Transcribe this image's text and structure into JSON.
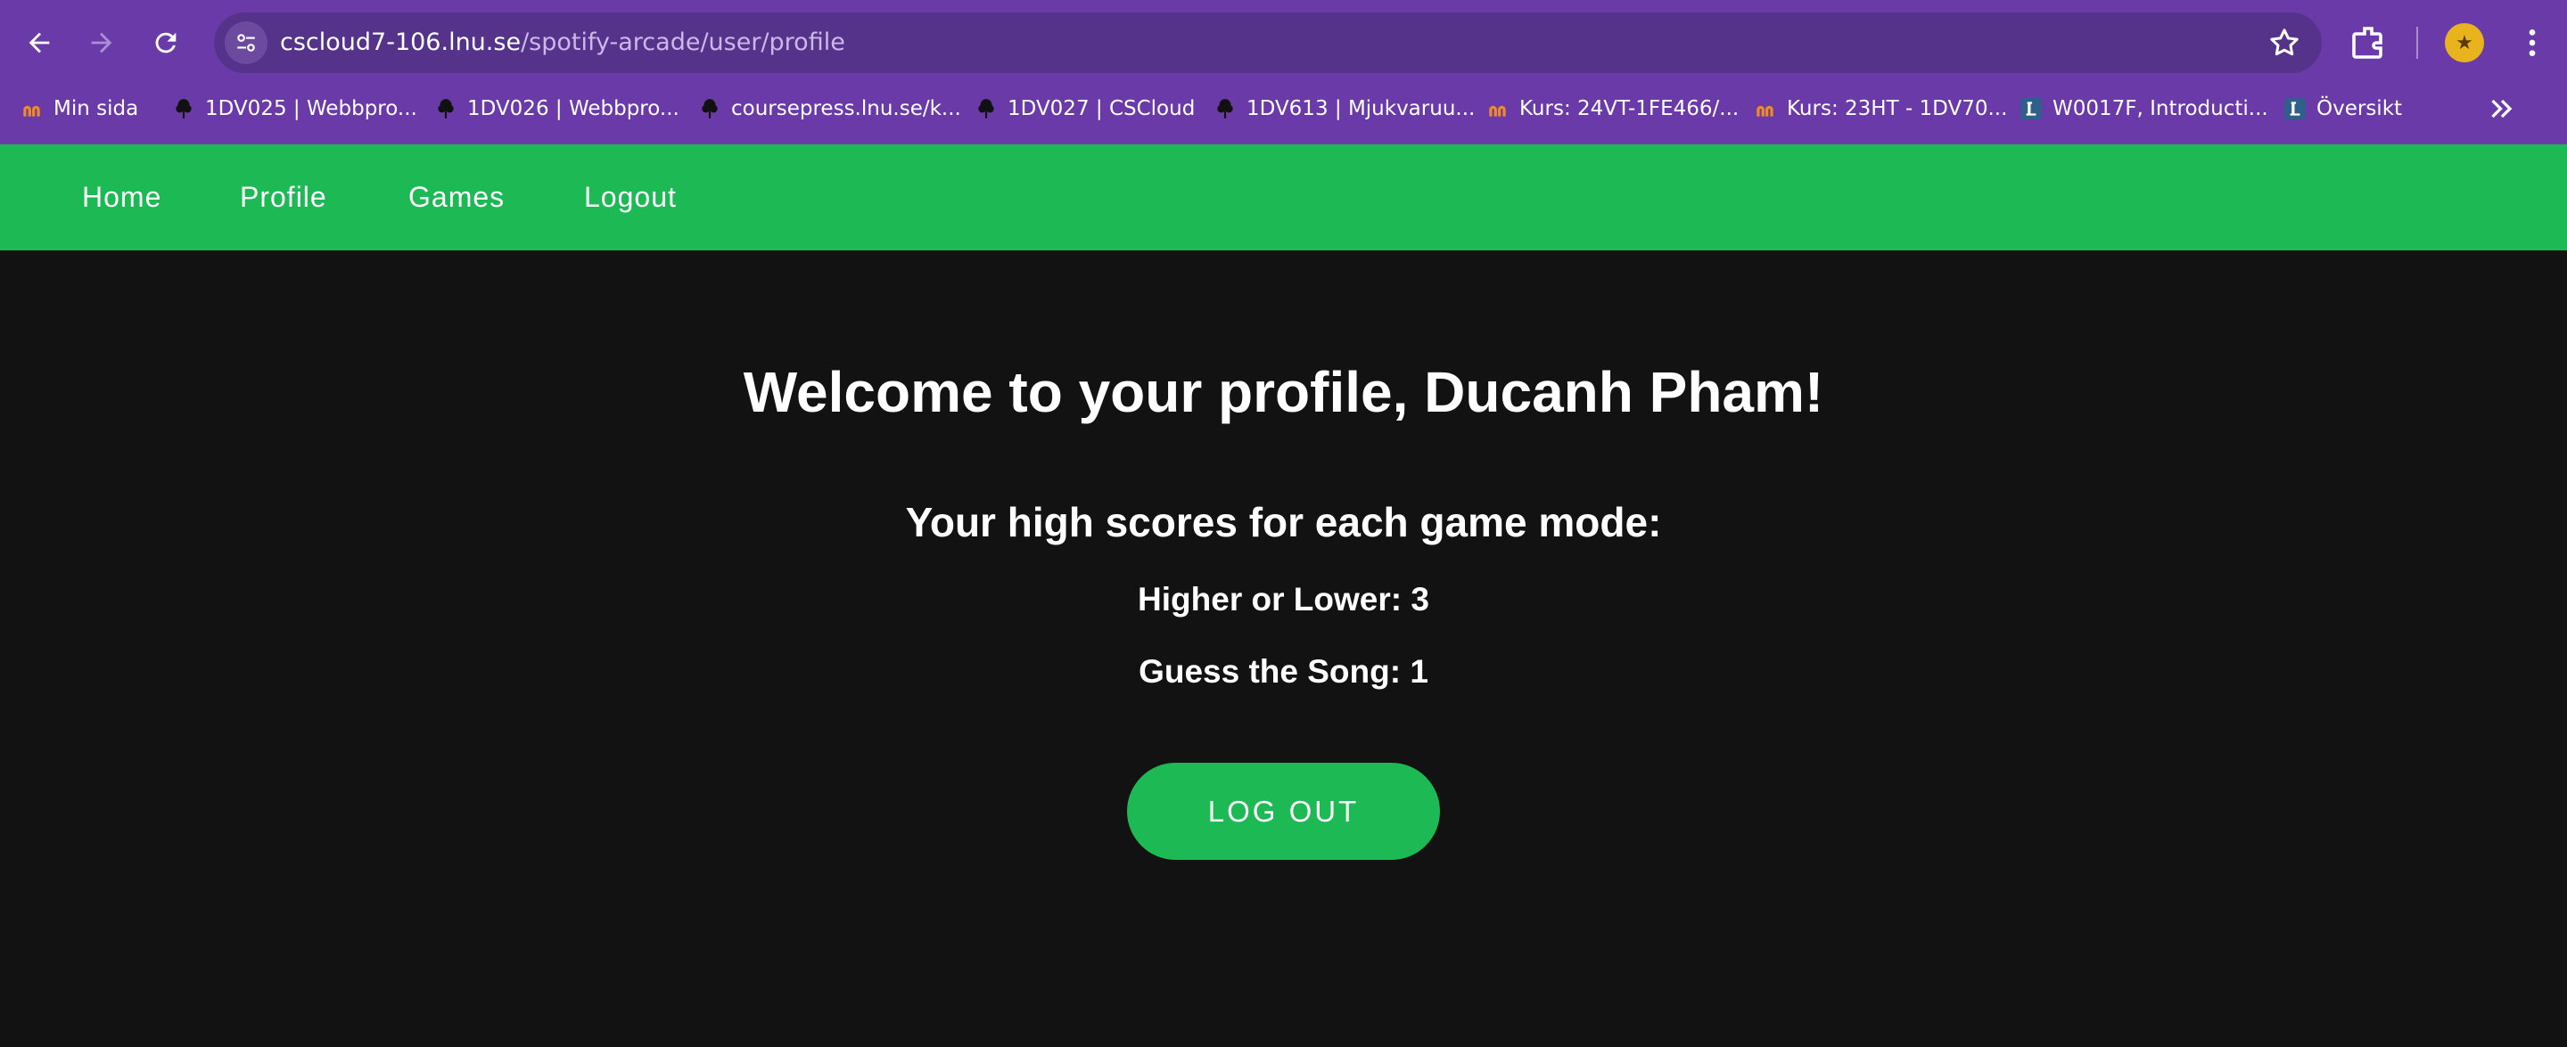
{
  "browser": {
    "url_host": "cscloud7-106.lnu.se",
    "url_path": "/spotify-arcade/user/profile",
    "bookmarks": [
      {
        "label": "Min sida",
        "icon": "moodle-icon"
      },
      {
        "label": "1DV025 | Webbpro...",
        "icon": "tree-icon"
      },
      {
        "label": "1DV026 | Webbpro...",
        "icon": "tree-icon"
      },
      {
        "label": "coursepress.lnu.se/k...",
        "icon": "tree-icon"
      },
      {
        "label": "1DV027 | CSCloud",
        "icon": "tree-icon"
      },
      {
        "label": "1DV613 | Mjukvaruu...",
        "icon": "tree-icon"
      },
      {
        "label": "Kurs: 24VT-1FE466/...",
        "icon": "moodle-icon"
      },
      {
        "label": "Kurs: 23HT - 1DV70...",
        "icon": "moodle-icon"
      },
      {
        "label": "W0017F, Introducti...",
        "icon": "l-icon"
      },
      {
        "label": "Översikt",
        "icon": "l-icon"
      }
    ]
  },
  "nav": {
    "home": "Home",
    "profile": "Profile",
    "games": "Games",
    "logout": "Logout"
  },
  "main": {
    "title": "Welcome to your profile, Ducanh Pham!",
    "subtitle": "Your high scores for each game mode:",
    "scores": [
      {
        "text": "Higher or Lower: 3"
      },
      {
        "text": "Guess the Song: 1"
      }
    ],
    "logout_button": "LOG OUT"
  },
  "colors": {
    "browser_frame": "#6a3aa8",
    "accent_green": "#1db954",
    "background": "#121212",
    "text": "#ffffff"
  }
}
